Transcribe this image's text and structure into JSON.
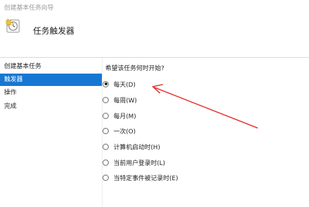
{
  "window": {
    "title": "创建基本任务向导"
  },
  "header": {
    "title": "任务触发器",
    "icon": "task-scheduler-icon"
  },
  "sidebar": {
    "items": [
      {
        "label": "创建基本任务",
        "active": false
      },
      {
        "label": "触发器",
        "active": true
      },
      {
        "label": "操作",
        "active": false
      },
      {
        "label": "完成",
        "active": false
      }
    ]
  },
  "main": {
    "question": "希望该任务何时开始?",
    "options": [
      {
        "label": "每天(D)",
        "checked": true
      },
      {
        "label": "每周(W)",
        "checked": false
      },
      {
        "label": "每月(M)",
        "checked": false
      },
      {
        "label": "一次(O)",
        "checked": false
      },
      {
        "label": "计算机启动时(H)",
        "checked": false
      },
      {
        "label": "当前用户登录时(L)",
        "checked": false
      },
      {
        "label": "当特定事件被记录时(E)",
        "checked": false
      }
    ]
  },
  "annotation": {
    "color": "#e53935",
    "icon": "red-arrow"
  },
  "colors": {
    "accent": "#1677d2"
  }
}
